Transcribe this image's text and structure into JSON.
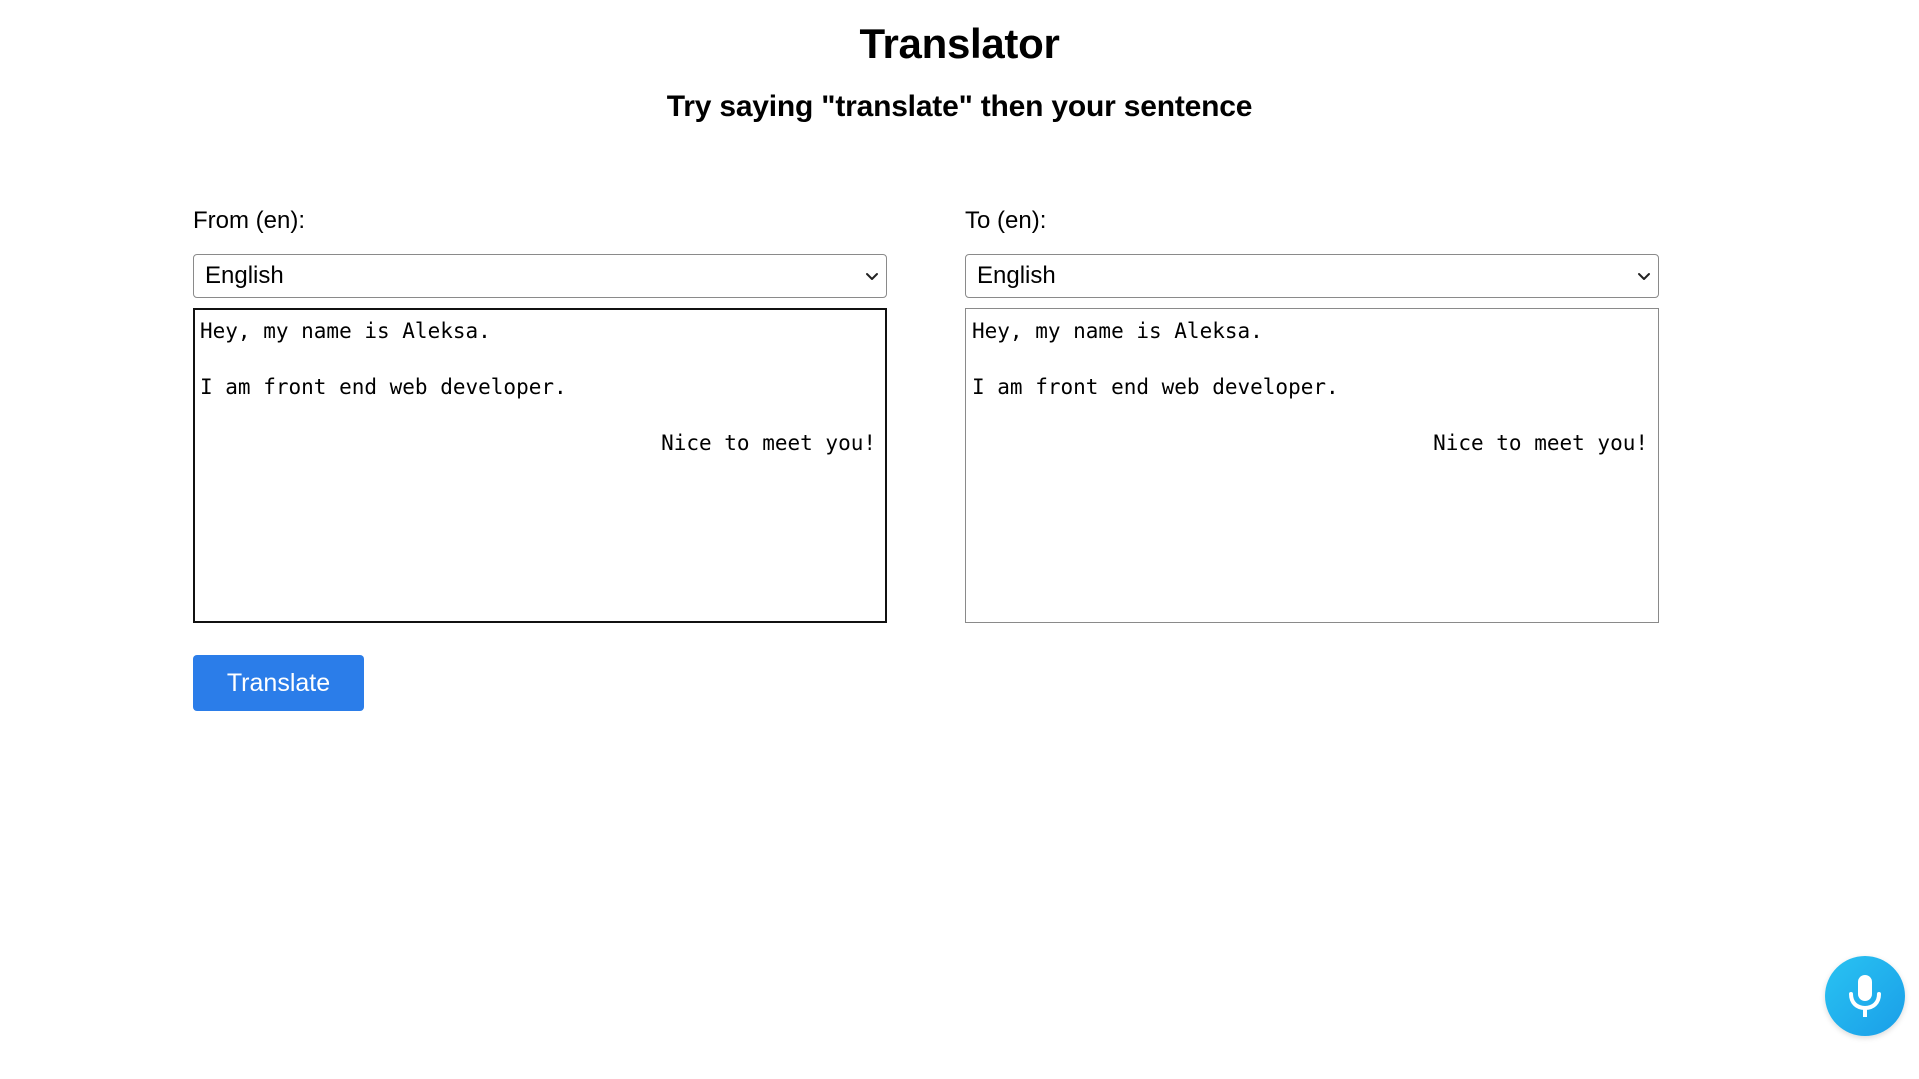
{
  "header": {
    "title": "Translator",
    "subtitle": "Try saying \"translate\" then your sentence"
  },
  "from": {
    "label": "From (en):",
    "selected_language": "English",
    "lines": [
      {
        "text": "Hey, my name is Aleksa.",
        "align": "left"
      },
      {
        "text": "",
        "align": "left"
      },
      {
        "text": "I am front end web developer.",
        "align": "left"
      },
      {
        "text": "",
        "align": "left"
      },
      {
        "text": "Nice to meet you!",
        "align": "right"
      }
    ]
  },
  "to": {
    "label": "To (en):",
    "selected_language": "English",
    "lines": [
      {
        "text": "Hey, my name is Aleksa.",
        "align": "left"
      },
      {
        "text": "",
        "align": "left"
      },
      {
        "text": "I am front end web developer.",
        "align": "left"
      },
      {
        "text": "",
        "align": "left"
      },
      {
        "text": "Nice to meet you!",
        "align": "right"
      }
    ]
  },
  "actions": {
    "translate_label": "Translate"
  },
  "icons": {
    "select_chevron": "chevron-down-icon",
    "mic": "microphone-icon"
  },
  "colors": {
    "accent": "#2b7de9",
    "mic_gradient_start": "#29c3f2",
    "mic_gradient_end": "#1a9ee8"
  }
}
